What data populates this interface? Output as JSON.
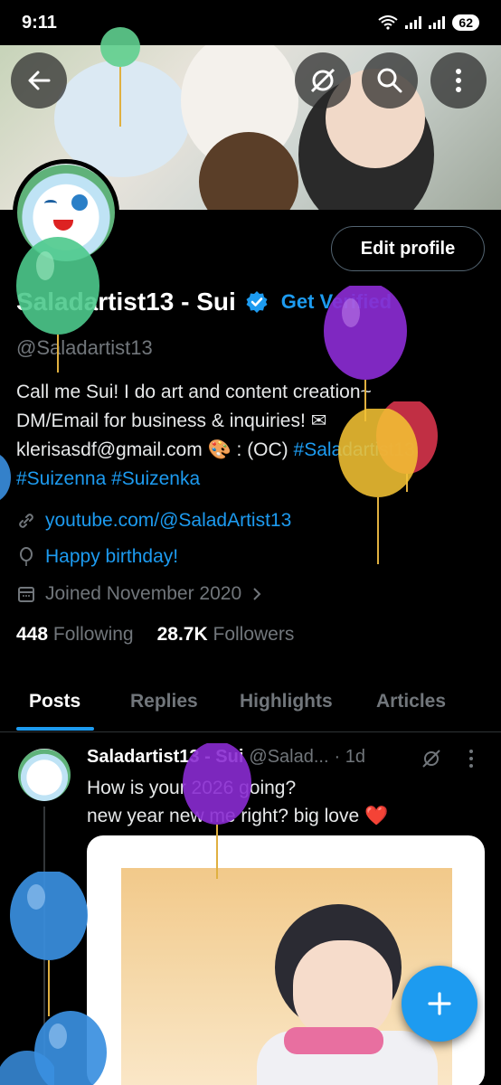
{
  "status_bar": {
    "time": "9:11",
    "battery": "62"
  },
  "profile": {
    "display_name": "Saladartist13 - Sui",
    "get_verified": "Get Verified",
    "handle": "@Saladartist13",
    "edit_profile": "Edit profile",
    "bio_parts": {
      "line1": "Call me Sui! I do art and content creation~",
      "line2": "DM/Email for business & inquiries! ✉",
      "line3_prefix": "klerisasdf@gmail.com 🎨 : (OC) ",
      "tag1": "#Saladartist13",
      "tag2": "#Suizenna",
      "tag3": "#Suizenka"
    },
    "website": "youtube.com/@SaladArtist13",
    "birthday": "Happy birthday!",
    "joined": "Joined November 2020",
    "following_count": "448",
    "following_label": "Following",
    "followers_count": "28.7K",
    "followers_label": "Followers"
  },
  "tabs": [
    "Posts",
    "Replies",
    "Highlights",
    "Articles"
  ],
  "post": {
    "author": "Saladartist13 - Sui",
    "handle": "@Salad...",
    "time": "· 1d",
    "text_line1": "How is your 2026 going?",
    "text_line2": "new year new me right? big love ❤️"
  },
  "colors": {
    "accent": "#1d9bf0",
    "background": "#000000",
    "muted": "#71767b"
  },
  "icons": {
    "back": "arrow-left-icon",
    "grok": "grok-icon",
    "search": "search-icon",
    "more": "more-vertical-icon",
    "verified": "verified-badge-icon",
    "link": "link-icon",
    "birthday": "balloon-icon",
    "calendar": "calendar-icon",
    "compose": "plus-icon"
  }
}
